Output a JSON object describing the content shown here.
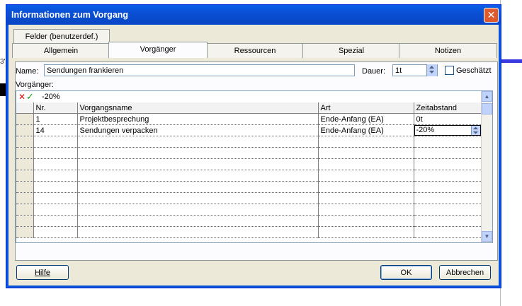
{
  "window": {
    "title": "Informationen zum Vorgang"
  },
  "background": {
    "left_text": "3'"
  },
  "tabs": {
    "row1": [
      {
        "label": "Felder (benutzerdef.)"
      }
    ],
    "row2": [
      {
        "label": "Allgemein"
      },
      {
        "label": "Vorgänger",
        "active": true
      },
      {
        "label": "Ressourcen"
      },
      {
        "label": "Spezial"
      },
      {
        "label": "Notizen"
      }
    ]
  },
  "form": {
    "name_label": "Name:",
    "name_value": "Sendungen frankieren",
    "duration_label": "Dauer:",
    "duration_value": "1t",
    "estimated_label": "Geschätzt",
    "estimated_checked": false,
    "predecessors_label": "Vorgänger:"
  },
  "entry_bar": {
    "value": "-20%"
  },
  "grid": {
    "columns": [
      "Nr.",
      "Vorgangsname",
      "Art",
      "Zeitabstand"
    ],
    "rows": [
      {
        "nr": "1",
        "name": "Projektbesprechung",
        "art": "Ende-Anfang (EA)",
        "lag": "0t"
      },
      {
        "nr": "14",
        "name": "Sendungen verpacken",
        "art": "Ende-Anfang (EA)",
        "lag": "-20%"
      }
    ],
    "empty_rows": 9
  },
  "buttons": {
    "help": "Hilfe",
    "ok": "OK",
    "cancel": "Abbrechen"
  },
  "colors": {
    "titlebar": "#0a5ee8",
    "dialog_bg": "#ece9d8",
    "close": "#e05a30"
  }
}
